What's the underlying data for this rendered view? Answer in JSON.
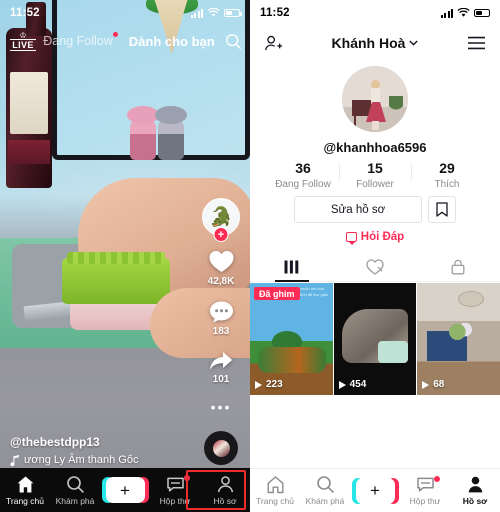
{
  "feed": {
    "status_bar": {
      "time": "11:52",
      "signal_icon": "signal-bars-icon",
      "wifi_icon": "wifi-icon",
      "battery_icon": "battery-icon"
    },
    "live_badge": {
      "label": "LIVE",
      "icon": "live-crown-icon"
    },
    "tabs": [
      {
        "label": "Đang Follow",
        "active": false,
        "has_dot": true
      },
      {
        "label": "Dành cho bạn",
        "active": true,
        "has_dot": false
      }
    ],
    "search_icon": "search-icon",
    "rail": {
      "avatar_icon": "creator-avatar-crocodile",
      "follow_label": "+",
      "like": {
        "icon": "heart-icon",
        "count": "42,8K"
      },
      "comment": {
        "icon": "comment-icon",
        "count": "183"
      },
      "share": {
        "icon": "share-arrow-icon",
        "count": "101"
      },
      "more_icon": "more-dots-icon",
      "music_disc_icon": "music-disc-icon"
    },
    "caption": {
      "username": "@thebestdpp13",
      "music_icon": "music-note-icon",
      "music": "ương Ly Âm thanh Gốc"
    },
    "nav": [
      {
        "label": "Trang chủ",
        "icon": "home-icon",
        "active": true,
        "dot": false
      },
      {
        "label": "Khám phá",
        "icon": "search-icon",
        "active": false,
        "dot": false
      },
      {
        "label": "",
        "icon": "plus-create-icon",
        "active": false,
        "dot": false
      },
      {
        "label": "Hộp thư",
        "icon": "inbox-icon",
        "active": false,
        "dot": true
      },
      {
        "label": "Hồ sơ",
        "icon": "profile-person-icon",
        "active": false,
        "dot": false
      }
    ],
    "highlight": {
      "target": "Hồ sơ",
      "color": "#ee2b2b"
    }
  },
  "profile": {
    "status_bar": {
      "time": "11:52",
      "signal_icon": "signal-bars-icon",
      "wifi_icon": "wifi-icon",
      "battery_icon": "battery-icon"
    },
    "header": {
      "add_friend_icon": "add-person-icon",
      "title": "Khánh Hoà",
      "chevron_icon": "chevron-down-icon",
      "menu_icon": "hamburger-menu-icon"
    },
    "avatar_icon": "profile-avatar-photo",
    "handle": "@khanhhoa6596",
    "stats": [
      {
        "value": "36",
        "label": "Đang Follow"
      },
      {
        "value": "15",
        "label": "Follower"
      },
      {
        "value": "29",
        "label": "Thích"
      }
    ],
    "edit_button": "Sửa hồ sơ",
    "bookmark_icon": "bookmark-icon",
    "qa_link": {
      "label": "Hỏi Đáp",
      "icon": "qa-bubble-icon",
      "color": "#fe2c55"
    },
    "tabs": [
      {
        "icon": "grid-videos-icon",
        "active": true
      },
      {
        "icon": "liked-heart-icon",
        "active": false
      },
      {
        "icon": "lock-private-icon",
        "active": false
      }
    ],
    "videos": [
      {
        "views": "223",
        "pinned_label": "Đã ghim",
        "highlighted": true,
        "caption": "khi bạn muốn tìm một nơi yên tĩnh để thư giãn"
      },
      {
        "views": "454",
        "pinned_label": "",
        "highlighted": false,
        "caption": ""
      },
      {
        "views": "68",
        "pinned_label": "",
        "highlighted": false,
        "caption": ""
      }
    ],
    "nav": [
      {
        "label": "Trang chủ",
        "icon": "home-icon",
        "active": false,
        "dot": false
      },
      {
        "label": "Khám phá",
        "icon": "search-icon",
        "active": false,
        "dot": false
      },
      {
        "label": "",
        "icon": "plus-create-icon",
        "active": false,
        "dot": false
      },
      {
        "label": "Hộp thư",
        "icon": "inbox-icon",
        "active": false,
        "dot": true
      },
      {
        "label": "Hồ sơ",
        "icon": "profile-person-icon",
        "active": true,
        "dot": false
      }
    ]
  }
}
